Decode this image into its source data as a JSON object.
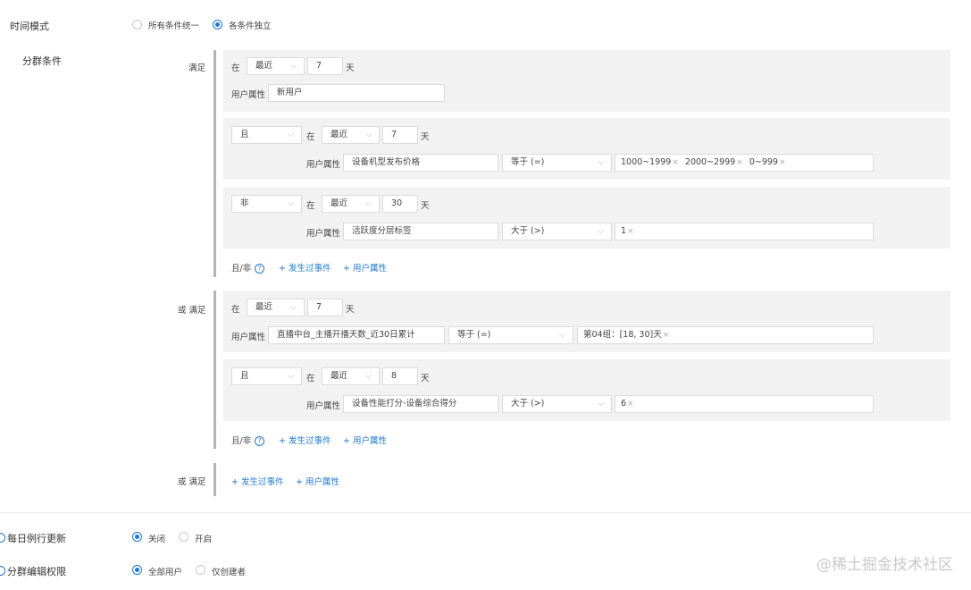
{
  "time_mode": {
    "label": "时间模式",
    "options": [
      "所有条件统一",
      "各条件独立"
    ],
    "selected": 1
  },
  "segment": {
    "label": "分群条件",
    "group1": {
      "prefix": "满足",
      "cond1": {
        "in": "在",
        "range": "最近",
        "num": "7",
        "unit": "天",
        "attr_label": "用户属性",
        "attr_value": "新用户"
      },
      "cond2": {
        "logic": "且",
        "in": "在",
        "range": "最近",
        "num": "7",
        "unit": "天",
        "attr_label": "用户属性",
        "attr_value": "设备机型发布价格",
        "op": "等于 (=)",
        "tags": [
          "1000~1999",
          "2000~2999",
          "0~999"
        ]
      },
      "cond3": {
        "logic": "非",
        "in": "在",
        "range": "最近",
        "num": "30",
        "unit": "天",
        "attr_label": "用户属性",
        "attr_value": "活跃度分层标签",
        "op": "大于 (>)",
        "tags": [
          "1"
        ]
      },
      "footer": {
        "andnot": "且/非",
        "add_event": "+ 发生过事件",
        "add_attr": "+ 用户属性"
      }
    },
    "group2": {
      "prefix": "或 满足",
      "cond1": {
        "in": "在",
        "range": "最近",
        "num": "7",
        "unit": "天",
        "attr_label": "用户属性",
        "attr_value": "直播中台_主播开播天数_近30日累计",
        "op": "等于 (=)",
        "tags": [
          "第04组：[18, 30]天"
        ]
      },
      "cond2": {
        "logic": "且",
        "in": "在",
        "range": "最近",
        "num": "8",
        "unit": "天",
        "attr_label": "用户属性",
        "attr_value": "设备性能打分-设备综合得分",
        "op": "大于 (>)",
        "tags": [
          "6"
        ]
      },
      "footer": {
        "andnot": "且/非",
        "add_event": "+ 发生过事件",
        "add_attr": "+ 用户属性"
      }
    },
    "group3": {
      "prefix": "或 满足",
      "add_event": "+ 发生过事件",
      "add_attr": "+ 用户属性"
    }
  },
  "daily_update": {
    "label": "每日例行更新",
    "options": [
      "关闭",
      "开启"
    ],
    "selected": 0
  },
  "edit_permission": {
    "label": "分群编辑权限",
    "options": [
      "全部用户",
      "仅创建者"
    ],
    "selected": 0
  },
  "watermark": "@稀土掘金技术社区",
  "colors": {
    "accent": "#1f77d0",
    "panel": "#f2f2f2",
    "bar": "#b4b4b4"
  }
}
